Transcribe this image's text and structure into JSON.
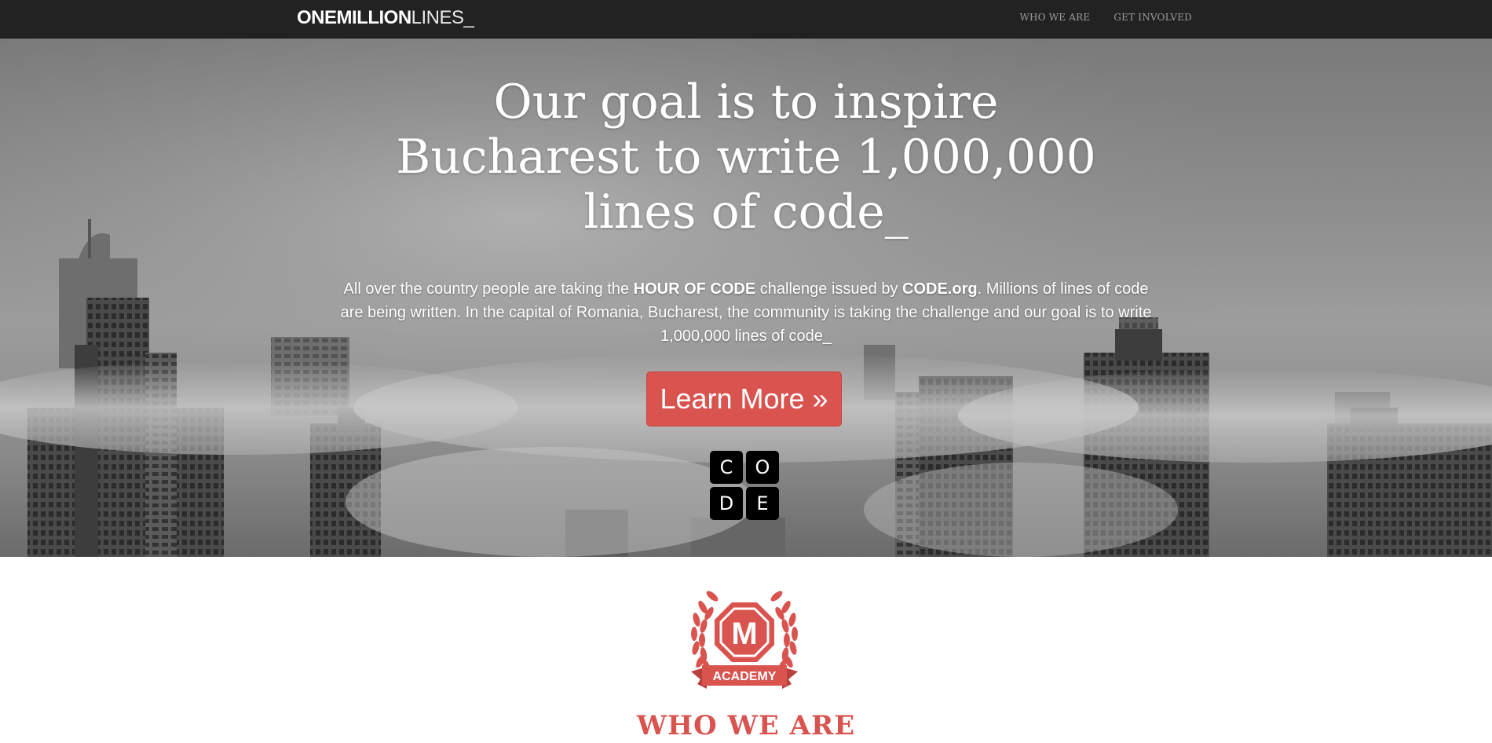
{
  "navbar": {
    "brand_bold": "ONEMILLION",
    "brand_light": "LINES_",
    "links": [
      "WHO WE ARE",
      "GET INVOLVED"
    ]
  },
  "hero": {
    "title_lines": [
      "Our goal is to inspire",
      "Bucharest to write 1,000,000",
      "lines of code_"
    ],
    "text": {
      "p1": "All over the country people are taking the ",
      "b1": "HOUR OF CODE",
      "p2": " challenge issued by ",
      "b2": "CODE.org",
      "p3": ". Millions of lines of code are being written. In the capital of Romania, Bucharest, the community is taking the challenge and our goal is to write 1,000,000 lines of code_"
    },
    "button_label": "Learn More »",
    "code_logo_letters": [
      "C",
      "O",
      "D",
      "E"
    ]
  },
  "about": {
    "badge_letter": "M",
    "badge_label": "ACADEMY",
    "title": "WHO WE ARE"
  },
  "colors": {
    "navbar_bg": "#222222",
    "accent": "#d9534f",
    "nav_link": "#9d9d9d"
  }
}
